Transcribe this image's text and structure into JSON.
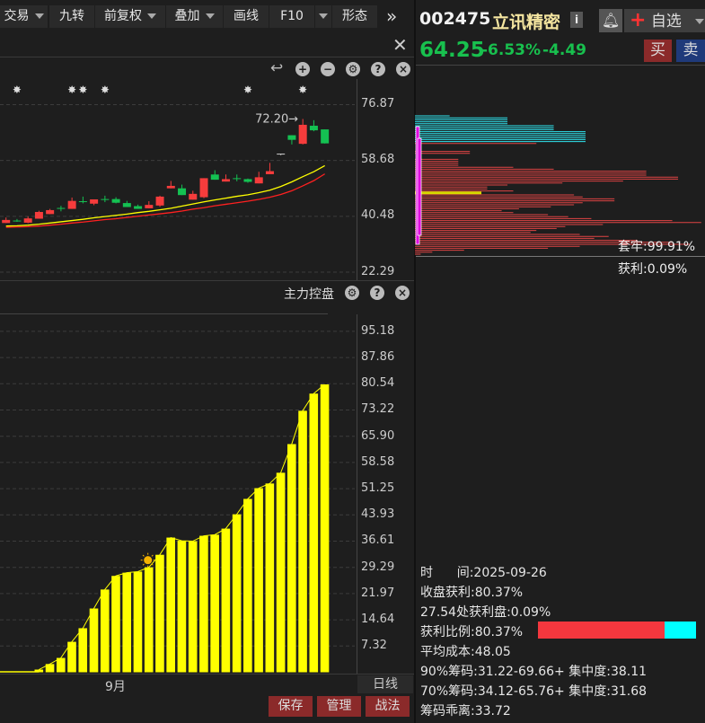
{
  "toolbar": {
    "items": [
      {
        "label": "交易",
        "dropdown": true
      },
      {
        "label": "九转",
        "dropdown": false
      },
      {
        "label": "前复权",
        "dropdown": true
      },
      {
        "label": "叠加",
        "dropdown": true
      },
      {
        "label": "画线",
        "dropdown": false
      },
      {
        "label": "F10",
        "dropdown": true
      },
      {
        "label": "形态",
        "dropdown": false
      }
    ],
    "more_icon": "double-chevron-right-icon",
    "close_icon": "close-icon"
  },
  "main_chart": {
    "icons": [
      "refresh-icon",
      "zoom-in-icon",
      "zoom-out-icon",
      "gear-icon",
      "help-icon",
      "close-icon"
    ],
    "y_ticks": [
      "76.87",
      "58.68",
      "40.48",
      "22.29"
    ],
    "y_range": [
      22.29,
      76.87
    ],
    "high_label": "72.20",
    "colors": {
      "up": "#f63c3c",
      "down": "#14c152",
      "ma1": "#ffff00",
      "ma2": "#ff2020"
    },
    "candles": [
      [
        38.3,
        39.3,
        40.1,
        38.3
      ],
      [
        39.1,
        39.1,
        39.6,
        38.7
      ],
      [
        38.4,
        39.8,
        40.4,
        38.2
      ],
      [
        39.7,
        41.9,
        42.3,
        39.7
      ],
      [
        41.2,
        42.5,
        42.9,
        41.2
      ],
      [
        43.2,
        43.2,
        43.9,
        42.1
      ],
      [
        42.9,
        45.5,
        46.6,
        42.9
      ],
      [
        45.4,
        45.4,
        46.9,
        44.7
      ],
      [
        44.6,
        46.0,
        46.0,
        44.1
      ],
      [
        46.1,
        46.1,
        47.2,
        45.1
      ],
      [
        46.1,
        44.9,
        46.7,
        44.7
      ],
      [
        44.8,
        43.5,
        45.5,
        43.5
      ],
      [
        43.8,
        42.9,
        44.3,
        42.9
      ],
      [
        43.1,
        44.2,
        45.4,
        43.1
      ],
      [
        44.0,
        46.9,
        47.2,
        43.6
      ],
      [
        49.6,
        50.4,
        52.0,
        49.6
      ],
      [
        49.6,
        47.4,
        50.8,
        47.4
      ],
      [
        45.9,
        47.8,
        48.8,
        45.9
      ],
      [
        46.7,
        52.9,
        52.9,
        46.4
      ],
      [
        54.1,
        52.4,
        55.5,
        52.4
      ],
      [
        51.8,
        52.6,
        54.1,
        51.8
      ],
      [
        52.9,
        52.9,
        54.1,
        51.9
      ],
      [
        52.6,
        51.7,
        52.8,
        51.4
      ],
      [
        51.2,
        53.2,
        55.0,
        51.2
      ],
      [
        54.2,
        55.2,
        57.9,
        54.2
      ],
      [
        60.9,
        60.9,
        60.9,
        60.4
      ],
      [
        66.9,
        65.4,
        66.9,
        63.9
      ],
      [
        64.1,
        70.3,
        72.2,
        63.9
      ],
      [
        70.0,
        68.5,
        71.8,
        68.2
      ],
      [
        68.8,
        64.25,
        68.8,
        64.2
      ]
    ],
    "ma1": [
      37.3,
      37.4,
      37.6,
      37.9,
      38.3,
      38.7,
      39.1,
      39.5,
      40.0,
      40.4,
      40.8,
      41.2,
      41.7,
      42.1,
      42.6,
      43.1,
      43.8,
      44.5,
      45.2,
      45.8,
      46.4,
      47.0,
      47.5,
      48.2,
      49.0,
      50.2,
      51.7,
      53.4,
      55.0,
      57.0
    ],
    "ma2": [
      36.9,
      37.0,
      37.1,
      37.3,
      37.6,
      37.9,
      38.3,
      38.6,
      39.0,
      39.4,
      39.7,
      40.1,
      40.5,
      40.9,
      41.3,
      41.7,
      42.2,
      42.8,
      43.3,
      43.9,
      44.4,
      44.9,
      45.4,
      46.0,
      46.7,
      47.6,
      48.8,
      50.4,
      52.1,
      54.3
    ],
    "star_marks": [
      1,
      6,
      7,
      9,
      22,
      27
    ]
  },
  "indicator": {
    "title": "主力控盘",
    "icons": [
      "gear-icon",
      "help-icon",
      "close-icon"
    ],
    "y_ticks": [
      "95.18",
      "87.86",
      "80.54",
      "73.22",
      "65.90",
      "58.58",
      "51.25",
      "43.93",
      "36.61",
      "29.29",
      "21.97",
      "14.64",
      "7.32"
    ],
    "y_range": [
      0,
      102.5
    ],
    "color": "#ffff00",
    "values": [
      0.75,
      2.3,
      4.0,
      8.5,
      12.3,
      17.8,
      23.1,
      26.9,
      27.8,
      28.1,
      29.3,
      32.8,
      37.6,
      36.7,
      36.6,
      38.1,
      38.4,
      40.1,
      44.1,
      48.4,
      51.4,
      52.7,
      55.7,
      63.7,
      73.0,
      77.8,
      80.37
    ],
    "sun_marker_index": 10,
    "sun_icon": "sun-icon"
  },
  "x_axis": {
    "month_label": "9月",
    "period": "日线"
  },
  "bottom_buttons": [
    "保存",
    "管理",
    "战法"
  ],
  "stock": {
    "code": "002475",
    "name": "立讯精密",
    "info_icon": "i",
    "price": "64.25",
    "change_pct": "-6.53%",
    "change": "-4.49",
    "price_color": "#18c04e",
    "bell_icon": "bell-icon",
    "watchlist_label": "自选",
    "buy_label": "买",
    "sell_label": "卖"
  },
  "chip": {
    "colors": {
      "trapped": "#2ee6f0",
      "profit": "#e04444",
      "avg": "#d8d800",
      "bracket": "#e000e0"
    },
    "trapped_label": "套牢:99.91%",
    "profit_label": "获利:0.09%",
    "distribution": [
      {
        "v": 12,
        "c": "trapped"
      },
      {
        "v": 32,
        "c": "trapped"
      },
      {
        "v": 32,
        "c": "trapped"
      },
      {
        "v": 32,
        "c": "trapped"
      },
      {
        "v": 32,
        "c": "trapped"
      },
      {
        "v": 48,
        "c": "trapped"
      },
      {
        "v": 48,
        "c": "trapped"
      },
      {
        "v": 48,
        "c": "trapped"
      },
      {
        "v": 59,
        "c": "trapped"
      },
      {
        "v": 59,
        "c": "trapped"
      },
      {
        "v": 59,
        "c": "trapped"
      },
      {
        "v": 59,
        "c": "trapped"
      },
      {
        "v": 59,
        "c": "trapped"
      },
      {
        "v": 59,
        "c": "trapped"
      },
      {
        "v": 42,
        "c": "profit"
      },
      {
        "v": 0,
        "c": "profit"
      },
      {
        "v": 0,
        "c": "profit"
      },
      {
        "v": 0,
        "c": "profit"
      },
      {
        "v": 19,
        "c": "profit"
      },
      {
        "v": 19,
        "c": "profit"
      },
      {
        "v": 0,
        "c": "profit"
      },
      {
        "v": 0,
        "c": "profit"
      },
      {
        "v": 15,
        "c": "profit"
      },
      {
        "v": 15,
        "c": "profit"
      },
      {
        "v": 15,
        "c": "profit"
      },
      {
        "v": 15,
        "c": "profit"
      },
      {
        "v": 34,
        "c": "profit"
      },
      {
        "v": 48,
        "c": "profit"
      },
      {
        "v": 80,
        "c": "profit"
      },
      {
        "v": 80,
        "c": "profit"
      },
      {
        "v": 80,
        "c": "profit"
      },
      {
        "v": 91,
        "c": "profit"
      },
      {
        "v": 91,
        "c": "profit"
      },
      {
        "v": 72,
        "c": "profit"
      },
      {
        "v": 51,
        "c": "profit"
      },
      {
        "v": 32,
        "c": "profit"
      },
      {
        "v": 25,
        "c": "profit"
      },
      {
        "v": 25,
        "c": "profit"
      },
      {
        "v": 34,
        "c": "profit"
      },
      {
        "v": 23,
        "c": "avg"
      },
      {
        "v": 55,
        "c": "profit"
      },
      {
        "v": 58,
        "c": "profit"
      },
      {
        "v": 69,
        "c": "profit"
      },
      {
        "v": 69,
        "c": "profit"
      },
      {
        "v": 58,
        "c": "profit"
      },
      {
        "v": 55,
        "c": "profit"
      },
      {
        "v": 47,
        "c": "profit"
      },
      {
        "v": 36,
        "c": "profit"
      },
      {
        "v": 30,
        "c": "profit"
      },
      {
        "v": 34,
        "c": "profit"
      },
      {
        "v": 46,
        "c": "profit"
      },
      {
        "v": 53,
        "c": "profit"
      },
      {
        "v": 61,
        "c": "profit"
      },
      {
        "v": 89,
        "c": "profit"
      },
      {
        "v": 99,
        "c": "profit"
      },
      {
        "v": 65,
        "c": "profit"
      },
      {
        "v": 52,
        "c": "profit"
      },
      {
        "v": 49,
        "c": "profit"
      },
      {
        "v": 42,
        "c": "profit"
      },
      {
        "v": 40,
        "c": "profit"
      },
      {
        "v": 57,
        "c": "profit"
      },
      {
        "v": 67,
        "c": "profit"
      },
      {
        "v": 62,
        "c": "profit"
      },
      {
        "v": 77,
        "c": "profit"
      },
      {
        "v": 89,
        "c": "profit"
      },
      {
        "v": 95,
        "c": "profit"
      },
      {
        "v": 57,
        "c": "profit"
      },
      {
        "v": 46,
        "c": "profit"
      },
      {
        "v": 17,
        "c": "profit"
      },
      {
        "v": 6,
        "c": "profit"
      },
      {
        "v": 2,
        "c": "profit"
      }
    ]
  },
  "stats": {
    "date": "时      间:2025-09-26",
    "close_profit": "收盘获利:80.37%",
    "price_profit": "27.54处获利盘:0.09%",
    "profit_ratio": "获利比例:80.37%",
    "profit_ratio_value": 80.37,
    "avg_cost": "平均成本:48.05",
    "chip90": "90%筹码:31.22-69.66+ 集中度:38.11",
    "chip70": "70%筹码:34.12-65.76+ 集中度:31.68",
    "deviation": "筹码乖离:33.72"
  }
}
